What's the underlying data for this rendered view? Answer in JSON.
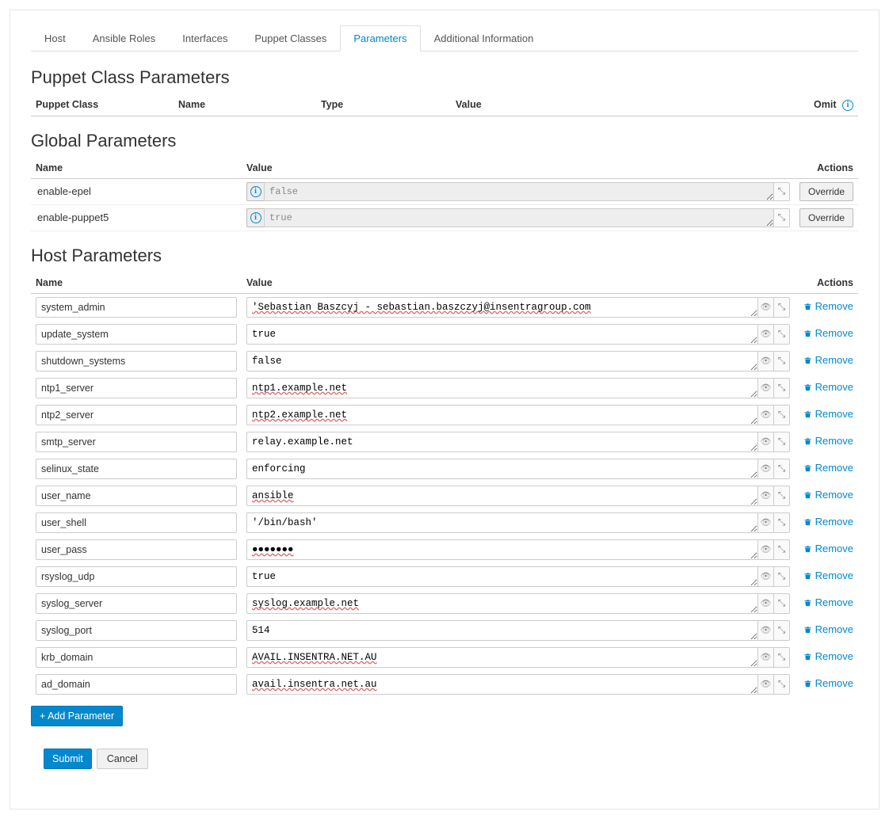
{
  "tabs": [
    {
      "label": "Host"
    },
    {
      "label": "Ansible Roles"
    },
    {
      "label": "Interfaces"
    },
    {
      "label": "Puppet Classes"
    },
    {
      "label": "Parameters",
      "active": true
    },
    {
      "label": "Additional Information"
    }
  ],
  "sections": {
    "puppet_class_params": {
      "title": "Puppet Class Parameters",
      "headers": {
        "puppet_class": "Puppet Class",
        "name": "Name",
        "type": "Type",
        "value": "Value",
        "omit": "Omit"
      }
    },
    "global_params": {
      "title": "Global Parameters",
      "headers": {
        "name": "Name",
        "value": "Value",
        "actions": "Actions"
      },
      "override_label": "Override",
      "rows": [
        {
          "name": "enable-epel",
          "value": "false"
        },
        {
          "name": "enable-puppet5",
          "value": "true"
        }
      ]
    },
    "host_params": {
      "title": "Host Parameters",
      "headers": {
        "name": "Name",
        "value": "Value",
        "actions": "Actions"
      },
      "remove_label": "Remove",
      "add_label": "+ Add Parameter",
      "rows": [
        {
          "name": "system_admin",
          "value": "'Sebastian Baszcyj - sebastian.baszczyj@insentragroup.com",
          "spell": true
        },
        {
          "name": "update_system",
          "value": "true"
        },
        {
          "name": "shutdown_systems",
          "value": "false"
        },
        {
          "name": "ntp1_server",
          "value": "ntp1.example.net",
          "spell": true
        },
        {
          "name": "ntp2_server",
          "value": "ntp2.example.net",
          "spell": true
        },
        {
          "name": "smtp_server",
          "value": "relay.example.net"
        },
        {
          "name": "selinux_state",
          "value": "enforcing"
        },
        {
          "name": "user_name",
          "value": "ansible",
          "spell": true
        },
        {
          "name": "user_shell",
          "value": "'/bin/bash'"
        },
        {
          "name": "user_pass",
          "value": "●●●●●●●",
          "spell": true
        },
        {
          "name": "rsyslog_udp",
          "value": "true"
        },
        {
          "name": "syslog_server",
          "value": "syslog.example.net",
          "spell": true
        },
        {
          "name": "syslog_port",
          "value": "514"
        },
        {
          "name": "krb_domain",
          "value": "AVAIL.INSENTRA.NET.AU",
          "spell": true
        },
        {
          "name": "ad_domain",
          "value": "avail.insentra.net.au",
          "spell": true
        }
      ]
    }
  },
  "buttons": {
    "submit": "Submit",
    "cancel": "Cancel"
  }
}
